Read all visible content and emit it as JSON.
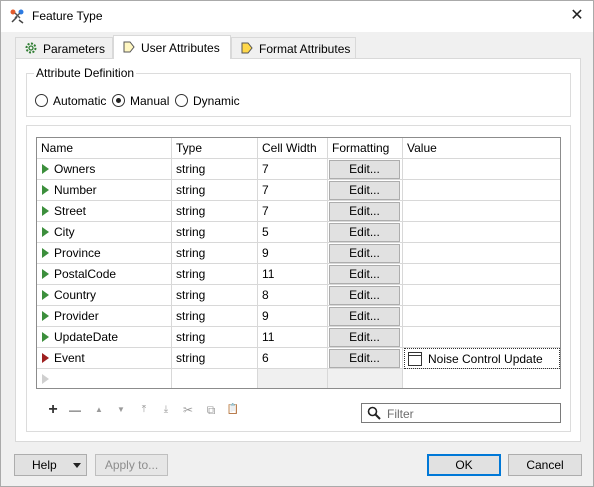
{
  "window": {
    "title": "Feature Type",
    "close": "✕"
  },
  "tabs": [
    {
      "label": "Parameters",
      "icon": "gear-icon",
      "active": false
    },
    {
      "label": "User Attributes",
      "icon": "user-attributes-icon",
      "active": true
    },
    {
      "label": "Format Attributes",
      "icon": "format-attributes-icon",
      "active": false
    }
  ],
  "attribute_definition": {
    "title": "Attribute Definition",
    "options": [
      "Automatic",
      "Manual",
      "Dynamic"
    ],
    "selected": "Manual"
  },
  "table": {
    "headers": [
      "Name",
      "Type",
      "Cell Width",
      "Formatting",
      "Value"
    ],
    "edit_label": "Edit...",
    "rows": [
      {
        "name": "Owners",
        "type": "string",
        "width": "7",
        "value": ""
      },
      {
        "name": "Number",
        "type": "string",
        "width": "7",
        "value": ""
      },
      {
        "name": "Street",
        "type": "string",
        "width": "7",
        "value": ""
      },
      {
        "name": "City",
        "type": "string",
        "width": "5",
        "value": ""
      },
      {
        "name": "Province",
        "type": "string",
        "width": "9",
        "value": ""
      },
      {
        "name": "PostalCode",
        "type": "string",
        "width": "11",
        "value": ""
      },
      {
        "name": "Country",
        "type": "string",
        "width": "8",
        "value": ""
      },
      {
        "name": "Provider",
        "type": "string",
        "width": "9",
        "value": ""
      },
      {
        "name": "UpdateDate",
        "type": "string",
        "width": "11",
        "value": ""
      },
      {
        "name": "Event",
        "type": "string",
        "width": "6",
        "value": "Noise Control Update"
      }
    ]
  },
  "toolbar": {
    "add": "+",
    "remove": "—",
    "up": "▲",
    "down": "▼",
    "top": "⤒",
    "bottom": "⤓",
    "cut": "✂",
    "copy": "⧉",
    "paste": "📋"
  },
  "filter": {
    "placeholder": "Filter"
  },
  "footer": {
    "help_label": "Help",
    "apply_label": "Apply to...",
    "ok_label": "OK",
    "cancel_label": "Cancel"
  },
  "colors": {
    "row_arrow": "#3c8f3c",
    "selected_row_arrow": "#9e2020",
    "accent": "#0078d7"
  }
}
